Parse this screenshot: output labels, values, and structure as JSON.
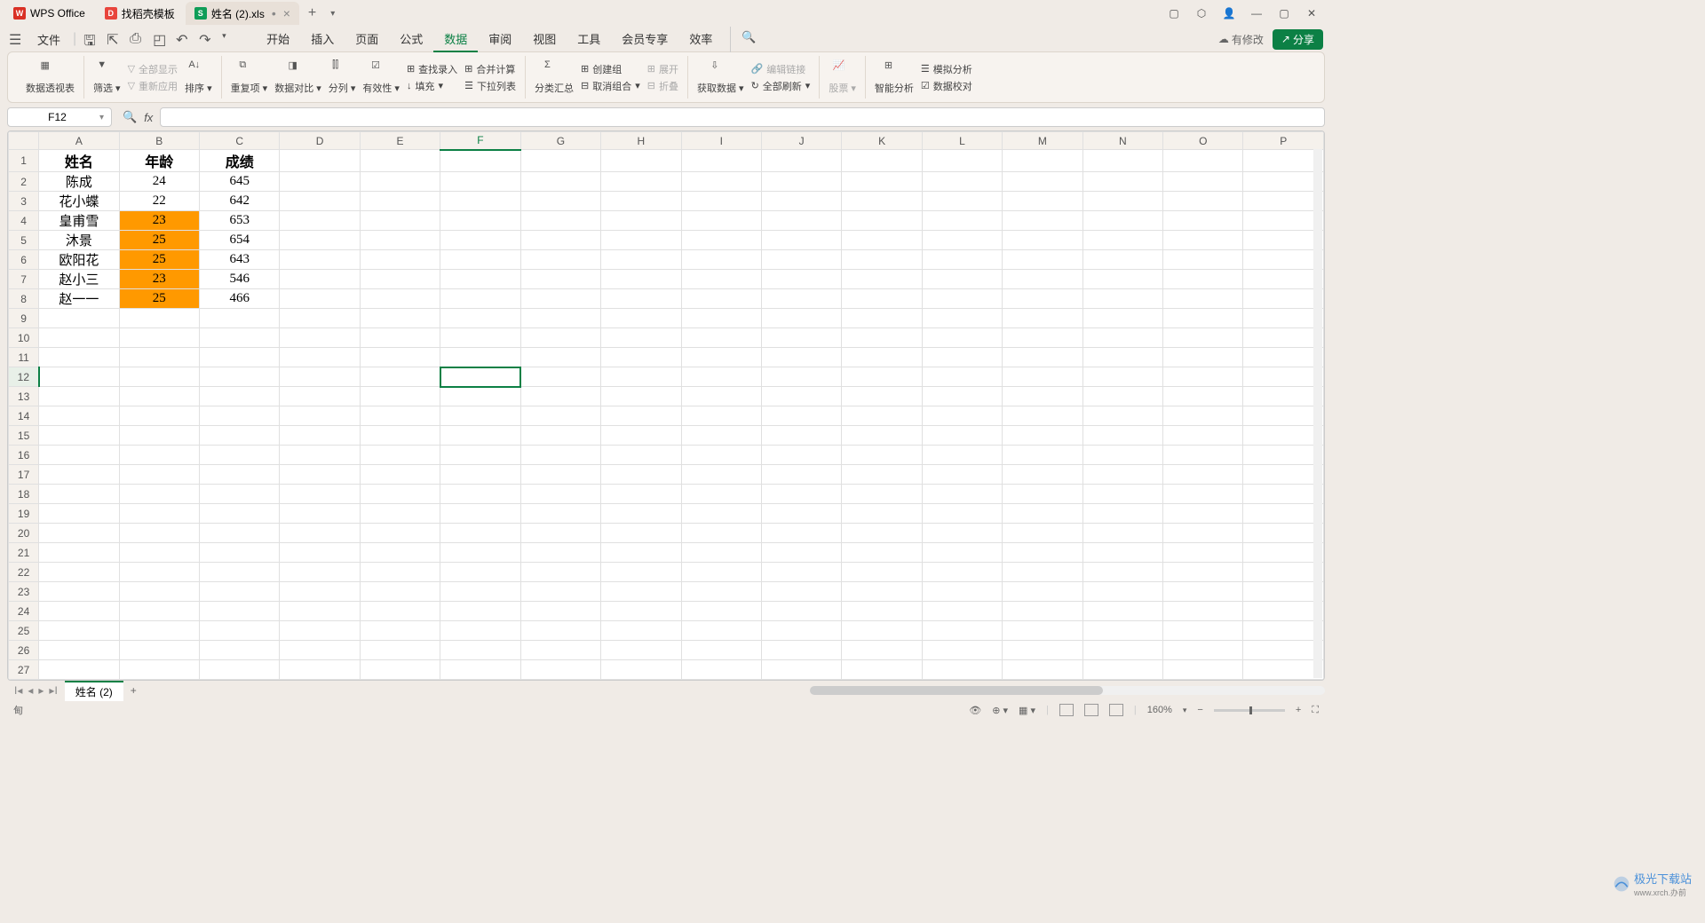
{
  "tabs": {
    "wps": "WPS Office",
    "template": "找稻壳模板",
    "active": "姓名 (2).xls"
  },
  "menu": {
    "file": "文件",
    "items": [
      "开始",
      "插入",
      "页面",
      "公式",
      "数据",
      "审阅",
      "视图",
      "工具",
      "会员专享",
      "效率"
    ],
    "active_index": 4,
    "modified": "有修改",
    "share": "分享"
  },
  "ribbon": {
    "pivot": "数据透视表",
    "filter": "筛选",
    "show_all": "全部显示",
    "reapply": "重新应用",
    "sort": "排序",
    "duplicates": "重复项",
    "compare": "数据对比",
    "split_col": "分列",
    "validation": "有效性",
    "fill": "填充",
    "find_input": "查找录入",
    "merge_calc": "合并计算",
    "dropdown": "下拉列表",
    "subtotal": "分类汇总",
    "group": "创建组",
    "ungroup": "取消组合",
    "expand": "展开",
    "collapse": "折叠",
    "get_data": "获取数据",
    "edit_link": "编辑链接",
    "refresh_all": "全部刷新",
    "stocks": "股票",
    "smart_analysis": "智能分析",
    "simulate": "模拟分析",
    "data_check": "数据校对"
  },
  "formula_bar": {
    "cell_ref": "F12",
    "fx": "fx"
  },
  "grid": {
    "columns": [
      "A",
      "B",
      "C",
      "D",
      "E",
      "F",
      "G",
      "H",
      "I",
      "J",
      "K",
      "L",
      "M",
      "N",
      "O",
      "P"
    ],
    "headers": [
      "姓名",
      "年龄",
      "成绩"
    ],
    "rows": [
      {
        "name": "陈成",
        "age": "24",
        "score": "645",
        "hl": false
      },
      {
        "name": "花小蝶",
        "age": "22",
        "score": "642",
        "hl": false
      },
      {
        "name": "皇甫雪",
        "age": "23",
        "score": "653",
        "hl": true
      },
      {
        "name": "沐景",
        "age": "25",
        "score": "654",
        "hl": true
      },
      {
        "name": "欧阳花",
        "age": "25",
        "score": "643",
        "hl": true
      },
      {
        "name": "赵小三",
        "age": "23",
        "score": "546",
        "hl": true
      },
      {
        "name": "赵一一",
        "age": "25",
        "score": "466",
        "hl": true
      }
    ],
    "total_rows": 27
  },
  "sheets": {
    "active": "姓名 (2)"
  },
  "statusbar": {
    "zoom": "160%",
    "indicator": "甸"
  },
  "watermark": {
    "text1": "极光下载站",
    "text2": "www.xrch.办前"
  }
}
